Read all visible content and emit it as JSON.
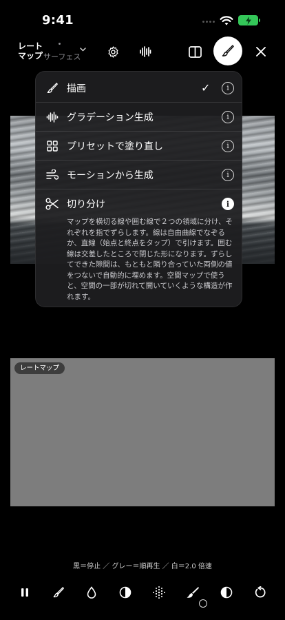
{
  "status_bar": {
    "time": "9:41"
  },
  "toolbar": {
    "mode_title": "レートマップ",
    "mode_subtitle": "サーフェス",
    "icons": [
      "gear-icon",
      "waveform-icon",
      "split-view-icon",
      "brush-icon",
      "close-icon"
    ]
  },
  "menu": {
    "items": [
      {
        "label": "描画",
        "icon": "brush-icon",
        "checked": true
      },
      {
        "label": "グラデーション生成",
        "icon": "waveform-icon",
        "checked": false
      },
      {
        "label": "プリセットで塗り直し",
        "icon": "grid-icon",
        "checked": false
      },
      {
        "label": "モーションから生成",
        "icon": "wind-icon",
        "checked": false
      },
      {
        "label": "切り分け",
        "icon": "scissors-icon",
        "checked": false,
        "expanded": true
      }
    ],
    "check_mark": "✓",
    "info_glyph": "i",
    "description": "マップを横切る線や囲む線で２つの領域に分け、それぞれを指でずらします。線は自由曲線でなぞるか、直線（始点と終点をタップ）で引けます。囲む線は交差したところで閉じた形になります。ずらしてできた隙間は、もともと隣り合っていた両側の値をつないで自動的に埋めます。空間マップで使うと、空間の一部が切れて開いていくような構造が作れます。"
  },
  "map_panel": {
    "tag": "レートマップ"
  },
  "legend": "黒＝停止 ／ グレー＝順再生 ／ 白＝2.0 倍速",
  "bottom_bar": {
    "icons": [
      "pause-icon",
      "brush-icon",
      "drop-icon",
      "contrast-icon",
      "dots-grid-icon",
      "smudge-brush-icon",
      "half-circle-icon",
      "undo-icon"
    ]
  },
  "colors": {
    "background": "#000000",
    "battery": "#34c759",
    "map": "#7d7d7d"
  }
}
